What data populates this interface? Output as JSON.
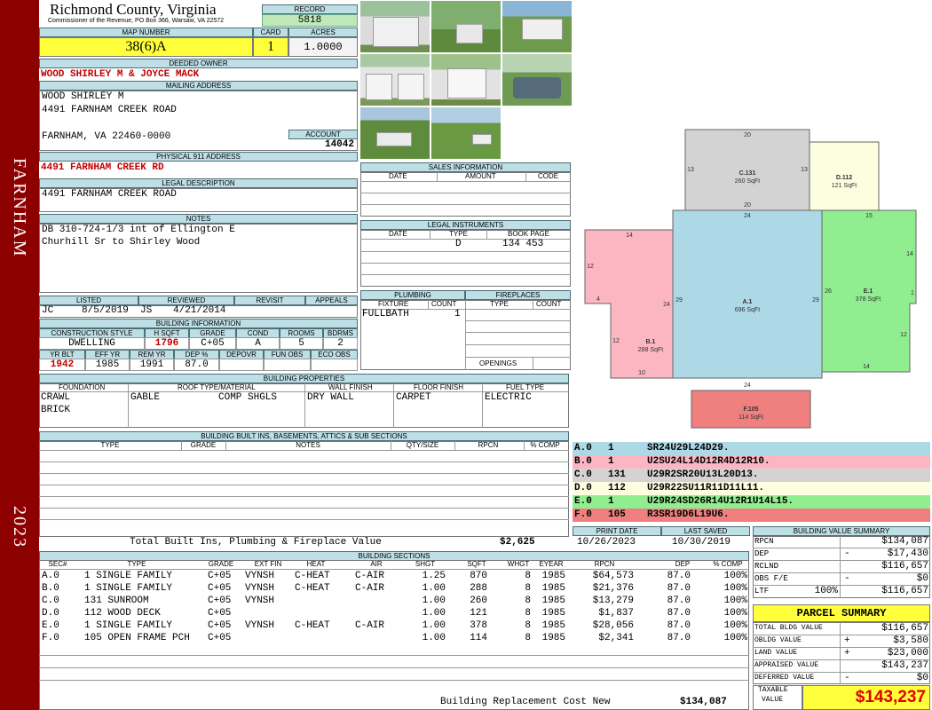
{
  "sidebar": {
    "district": "FARNHAM",
    "year": "2023"
  },
  "county": {
    "name": "Richmond County, Virginia",
    "address": "Commissioner of the Revenue, PO Box 366, Warsaw, VA 22572"
  },
  "record": {
    "label": "RECORD",
    "value": "5818"
  },
  "map": {
    "label": "MAP NUMBER",
    "value": "38(6)A"
  },
  "card": {
    "label": "CARD",
    "value": "1"
  },
  "acres": {
    "label": "ACRES",
    "value": "1.0000"
  },
  "owner": {
    "label": "DEEDED OWNER",
    "value": "WOOD SHIRLEY M & JOYCE MACK"
  },
  "mailing": {
    "label": "MAILING ADDRESS",
    "line1": "WOOD SHIRLEY M",
    "line2": "4491 FARNHAM CREEK ROAD",
    "line3": "FARNHAM, VA 22460-0000"
  },
  "account": {
    "label": "ACCOUNT",
    "value": "14042"
  },
  "physical": {
    "label": "PHYSICAL 911 ADDRESS",
    "value": "4491 FARNHAM CREEK RD"
  },
  "legal": {
    "label": "LEGAL DESCRIPTION",
    "value": "4491 FARNHAM CREEK ROAD"
  },
  "notes": {
    "label": "NOTES",
    "line1": "DB 310-724-1/3 int of Ellington E",
    "line2": "Churhill Sr to Shirley Wood"
  },
  "sales": {
    "label": "SALES INFORMATION",
    "cols": [
      "DATE",
      "AMOUNT",
      "CODE"
    ]
  },
  "instruments": {
    "label": "LEGAL INSTRUMENTS",
    "cols": [
      "DATE",
      "TYPE",
      "BOOK PAGE"
    ],
    "type": "D",
    "bookpage": "134 453"
  },
  "status": {
    "listed_label": "LISTED",
    "reviewed_label": "REVIEWED",
    "revisit_label": "REVISIT",
    "appeals_label": "APPEALS",
    "listed_by": "JC",
    "listed_date": "8/5/2019",
    "reviewed_by": "JS",
    "reviewed_date": "4/21/2014"
  },
  "plumbing": {
    "label": "PLUMBING",
    "fixture_label": "FIXTURE",
    "count_label": "COUNT",
    "fixture": "FULLBATH",
    "count": "1"
  },
  "fireplaces": {
    "label": "FIREPLACES",
    "type_label": "TYPE",
    "count_label": "COUNT",
    "openings_label": "OPENINGS"
  },
  "building_info": {
    "label": "BUILDING INFORMATION",
    "cols1": [
      "CONSTRUCTION STYLE",
      "H SQFT",
      "GRADE",
      "COND",
      "ROOMS",
      "BDRMS"
    ],
    "vals1": [
      "DWELLING",
      "1796",
      "C+05",
      "A",
      "5",
      "2"
    ],
    "cols2": [
      "YR BLT",
      "EFF YR",
      "REM YR",
      "DEP %",
      "DEPOVR",
      "FUN OBS",
      "ECO OBS"
    ],
    "vals2": [
      "1942",
      "1985",
      "1991",
      "87.0",
      "",
      "",
      ""
    ]
  },
  "props": {
    "label": "BUILDING PROPERTIES",
    "cols": [
      "FOUNDATION",
      "ROOF TYPE/MATERIAL",
      "WALL FINISH",
      "FLOOR FINISH",
      "FUEL TYPE"
    ],
    "foundation1": "CRAWL",
    "foundation2": "BRICK",
    "roof_type": "GABLE",
    "roof_mat": "COMP SHGLS",
    "wall": "DRY WALL",
    "floor": "CARPET",
    "fuel": "ELECTRIC"
  },
  "builtins": {
    "label": "BUILDING BUILT INS, BASEMENTS, ATTICS & SUB SECTIONS",
    "cols": [
      "TYPE",
      "GRADE",
      "NOTES",
      "QTY/SIZE",
      "RPCN",
      "% COMP"
    ],
    "total_label": "Total Built Ins, Plumbing & Fireplace Value",
    "total_value": "$2,625"
  },
  "dates": {
    "print_label": "PRINT DATE",
    "print_value": "10/26/2023",
    "saved_label": "LAST SAVED",
    "saved_value": "10/30/2019"
  },
  "sections": {
    "label": "BUILDING SECTIONS",
    "cols": [
      "SEC#",
      "TYPE",
      "GRADE",
      "EXT FIN",
      "HEAT",
      "AIR",
      "SHGT",
      "SQFT",
      "WHGT",
      "EYEAR",
      "RPCN",
      "DEP",
      "% COMP"
    ],
    "rows": [
      [
        "A.0",
        "1 SINGLE FAMILY",
        "C+05",
        "VYNSH",
        "C-HEAT",
        "C-AIR",
        "1.25",
        "870",
        "8",
        "1985",
        "$64,573",
        "87.0",
        "100%"
      ],
      [
        "B.0",
        "1 SINGLE FAMILY",
        "C+05",
        "VYNSH",
        "C-HEAT",
        "C-AIR",
        "1.00",
        "288",
        "8",
        "1985",
        "$21,376",
        "87.0",
        "100%"
      ],
      [
        "C.0",
        "131 SUNROOM",
        "C+05",
        "VYNSH",
        "",
        "",
        "1.00",
        "260",
        "8",
        "1985",
        "$13,279",
        "87.0",
        "100%"
      ],
      [
        "D.0",
        "112 WOOD DECK",
        "C+05",
        "",
        "",
        "",
        "1.00",
        "121",
        "8",
        "1985",
        "$1,837",
        "87.0",
        "100%"
      ],
      [
        "E.0",
        "1 SINGLE FAMILY",
        "C+05",
        "VYNSH",
        "C-HEAT",
        "C-AIR",
        "1.00",
        "378",
        "8",
        "1985",
        "$28,056",
        "87.0",
        "100%"
      ],
      [
        "F.0",
        "105 OPEN FRAME PCH",
        "C+05",
        "",
        "",
        "",
        "1.00",
        "114",
        "8",
        "1985",
        "$2,341",
        "87.0",
        "100%"
      ]
    ],
    "replacement_label": "Building Replacement Cost New",
    "replacement_value": "$134,087"
  },
  "sketch": {
    "labels": [
      {
        "id": "C.131",
        "area": "260 SqFt",
        "color": "#d3d3d3"
      },
      {
        "id": "D.112",
        "area": "121 SqFt",
        "color": "#fdfde0"
      },
      {
        "id": "A.1",
        "area": "696 SqFt",
        "color": "#add8e6"
      },
      {
        "id": "B.1",
        "area": "288 SqFt",
        "color": "#fbb6c1"
      },
      {
        "id": "E.1",
        "area": "378 SqFt",
        "color": "#90ee90"
      },
      {
        "id": "F.105",
        "area": "114 SqFt",
        "color": "#f08080"
      }
    ],
    "dims": [
      "20",
      "13",
      "13",
      "20",
      "24",
      "15",
      "14",
      "12",
      "4",
      "24",
      "29",
      "29",
      "26",
      "1",
      "14",
      "12",
      "12",
      "10",
      "24",
      "14"
    ]
  },
  "codes": [
    {
      "sec": "A.0",
      "num": "1",
      "code": "SR24U29L24D29.",
      "color": "#add8e6"
    },
    {
      "sec": "B.0",
      "num": "1",
      "code": "U2SU24L14D12R4D12R10.",
      "color": "#fbb6c1"
    },
    {
      "sec": "C.0",
      "num": "131",
      "code": "U29R2SR20U13L20D13.",
      "color": "#d3d3d3"
    },
    {
      "sec": "D.0",
      "num": "112",
      "code": "U29R22SU11R11D11L11.",
      "color": "#fdfde0"
    },
    {
      "sec": "E.0",
      "num": "1",
      "code": "U29R24SD26R14U12R1U14L15.",
      "color": "#90ee90"
    },
    {
      "sec": "F.0",
      "num": "105",
      "code": "R3SR19D6L19U6.",
      "color": "#f08080"
    }
  ],
  "value_summary": {
    "label": "BUILDING VALUE SUMMARY",
    "rpcn_label": "RPCN",
    "rpcn": "$134,087",
    "dep_label": "DEP",
    "dep_sign": "-",
    "dep": "$17,430",
    "rclnd_label": "RCLND",
    "rclnd": "$116,657",
    "obs_label": "OBS F/E",
    "obs_sign": "-",
    "obs": "$0",
    "ltf_label": "LTF",
    "ltf_pct": "100%",
    "ltf": "$116,657"
  },
  "parcel": {
    "label": "PARCEL SUMMARY",
    "bldg_label": "TOTAL BLDG VALUE",
    "bldg": "$116,657",
    "obldg_label": "OBLDG VALUE",
    "obldg_sign": "+",
    "obldg": "$3,580",
    "land_label": "LAND VALUE",
    "land_sign": "+",
    "land": "$23,000",
    "appraised_label": "APPRAISED VALUE",
    "appraised": "$143,237",
    "deferred_label": "DEFERRED VALUE",
    "deferred_sign": "-",
    "deferred": "$0",
    "taxable_label1": "TAXABLE",
    "taxable_label2": "VALUE",
    "taxable": "$143,237"
  },
  "photos": [
    {
      "name": "garage-photo-1"
    },
    {
      "name": "shed-photo"
    },
    {
      "name": "house-photo-1"
    },
    {
      "name": "garage-photo-2"
    },
    {
      "name": "garage-photo-3"
    },
    {
      "name": "truck-photo"
    },
    {
      "name": "house-photo-2"
    },
    {
      "name": "yard-photo"
    }
  ]
}
